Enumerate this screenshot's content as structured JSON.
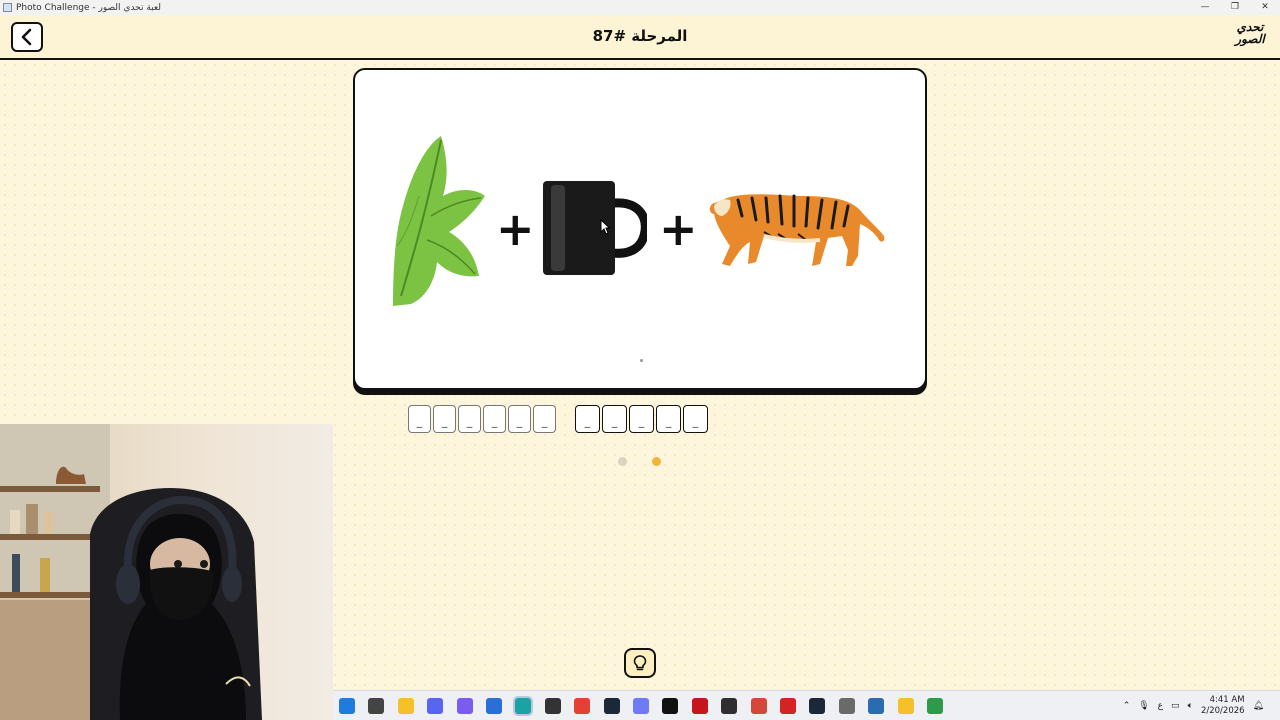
{
  "window": {
    "title": "Photo Challenge - لعبة تحدي الصور",
    "controls": [
      "—",
      "❐",
      "✕"
    ]
  },
  "header": {
    "title": "المرحلة #87",
    "logo_text": "تحدي الصور",
    "back_icon": "chevron-left-icon"
  },
  "puzzle": {
    "images": [
      "mint-leaves",
      "black-mug",
      "tiger"
    ],
    "operator": "+"
  },
  "answer": {
    "word1_slots": [
      "_",
      "_",
      "_",
      "_",
      "_",
      "_"
    ],
    "word2_slots": [
      "_",
      "_",
      "_",
      "_",
      "_"
    ]
  },
  "pagination": {
    "colors": [
      "#d9d3c0",
      "#f2b53a"
    ]
  },
  "hint": {
    "icon": "lightbulb-icon"
  },
  "taskbar": {
    "time": "4:41 AM",
    "date": "2/20/2026",
    "tray_icons": [
      "chevron-up-icon",
      "microphone-icon",
      "language-icon",
      "network-icon",
      "volume-icon",
      "notification-icon"
    ],
    "apps": [
      {
        "icon": "windows-start-icon",
        "color": "#1e7be0"
      },
      {
        "icon": "task-view-icon",
        "color": "#444"
      },
      {
        "icon": "file-explorer-icon",
        "color": "#f5c02a"
      },
      {
        "icon": "discord-icon",
        "color": "#5865f2"
      },
      {
        "icon": "copilot-icon",
        "color": "#7a5cf0"
      },
      {
        "icon": "store-icon",
        "color": "#2a6fd6"
      },
      {
        "icon": "edge-icon",
        "color": "#1aa3a3"
      },
      {
        "icon": "unity-icon",
        "color": "#333"
      },
      {
        "icon": "chrome-icon",
        "color": "#e44134"
      },
      {
        "icon": "steam-icon",
        "color": "#1b2838"
      },
      {
        "icon": "discord-canary-icon",
        "color": "#6f7bf5"
      },
      {
        "icon": "capcut-icon",
        "color": "#111"
      },
      {
        "icon": "acrobat-icon",
        "color": "#c4161c"
      },
      {
        "icon": "obs-icon",
        "color": "#302e31"
      },
      {
        "icon": "ppt-icon",
        "color": "#d4473b"
      },
      {
        "icon": "wps-icon",
        "color": "#d32323"
      },
      {
        "icon": "steam-2-icon",
        "color": "#1b2838"
      },
      {
        "icon": "settings-icon",
        "color": "#6a6a6a"
      },
      {
        "icon": "app-icon",
        "color": "#2b6cb0"
      },
      {
        "icon": "pencil-icon",
        "color": "#f5c02a"
      },
      {
        "icon": "chrome-2-icon",
        "color": "#2c9c4a"
      }
    ]
  }
}
